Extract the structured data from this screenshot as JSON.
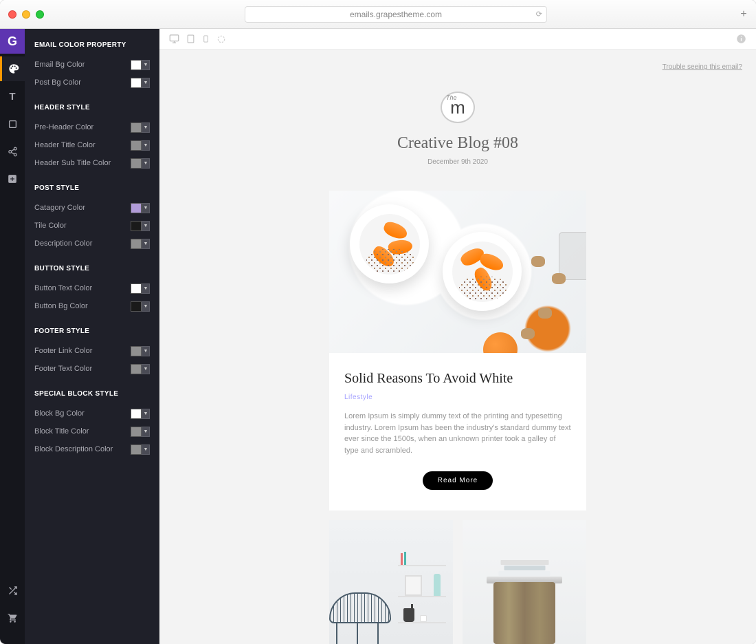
{
  "browser": {
    "url": "emails.grapestheme.com"
  },
  "rail": {
    "logo": "G"
  },
  "sidebar": {
    "sections": [
      {
        "title": "EMAIL COLOR PROPERTY",
        "items": [
          {
            "label": "Email Bg Color",
            "color": "#ffffff"
          },
          {
            "label": "Post Bg Color",
            "color": "#ffffff"
          }
        ]
      },
      {
        "title": "HEADER STYLE",
        "items": [
          {
            "label": "Pre-Header Color",
            "color": "#909090"
          },
          {
            "label": "Header Title Color",
            "color": "#909090"
          },
          {
            "label": "Header Sub Title Color",
            "color": "#909090"
          }
        ]
      },
      {
        "title": "POST STYLE",
        "items": [
          {
            "label": "Catagory Color",
            "color": "#b19cd9"
          },
          {
            "label": "Tile Color",
            "color": "#1a1a1a"
          },
          {
            "label": "Description Color",
            "color": "#909090"
          }
        ]
      },
      {
        "title": "BUTTON STYLE",
        "items": [
          {
            "label": "Button Text Color",
            "color": "#ffffff"
          },
          {
            "label": "Button Bg Color",
            "color": "#1a1a1a"
          }
        ]
      },
      {
        "title": "FOOTER STYLE",
        "items": [
          {
            "label": "Footer Link Color",
            "color": "#909090"
          },
          {
            "label": "Footer Text Color",
            "color": "#909090"
          }
        ]
      },
      {
        "title": "SPECIAL BLOCK STYLE",
        "items": [
          {
            "label": "Block Bg Color",
            "color": "#ffffff"
          },
          {
            "label": "Block Title Color",
            "color": "#909090"
          },
          {
            "label": "Block Description Color",
            "color": "#909090"
          }
        ]
      }
    ]
  },
  "preview": {
    "troubleText": "Trouble seeing this email?",
    "logoThe": "The",
    "logoM": "m",
    "title": "Creative Blog #08",
    "date": "December 9th 2020",
    "post": {
      "title": "Solid Reasons To Avoid White",
      "category": "Lifestyle",
      "description": "Lorem Ipsum is simply dummy text of the printing and typesetting industry. Lorem Ipsum has been the industry's standard dummy text ever since the 1500s, when an unknown printer took a galley of type and scrambled.",
      "button": "Read More"
    }
  }
}
